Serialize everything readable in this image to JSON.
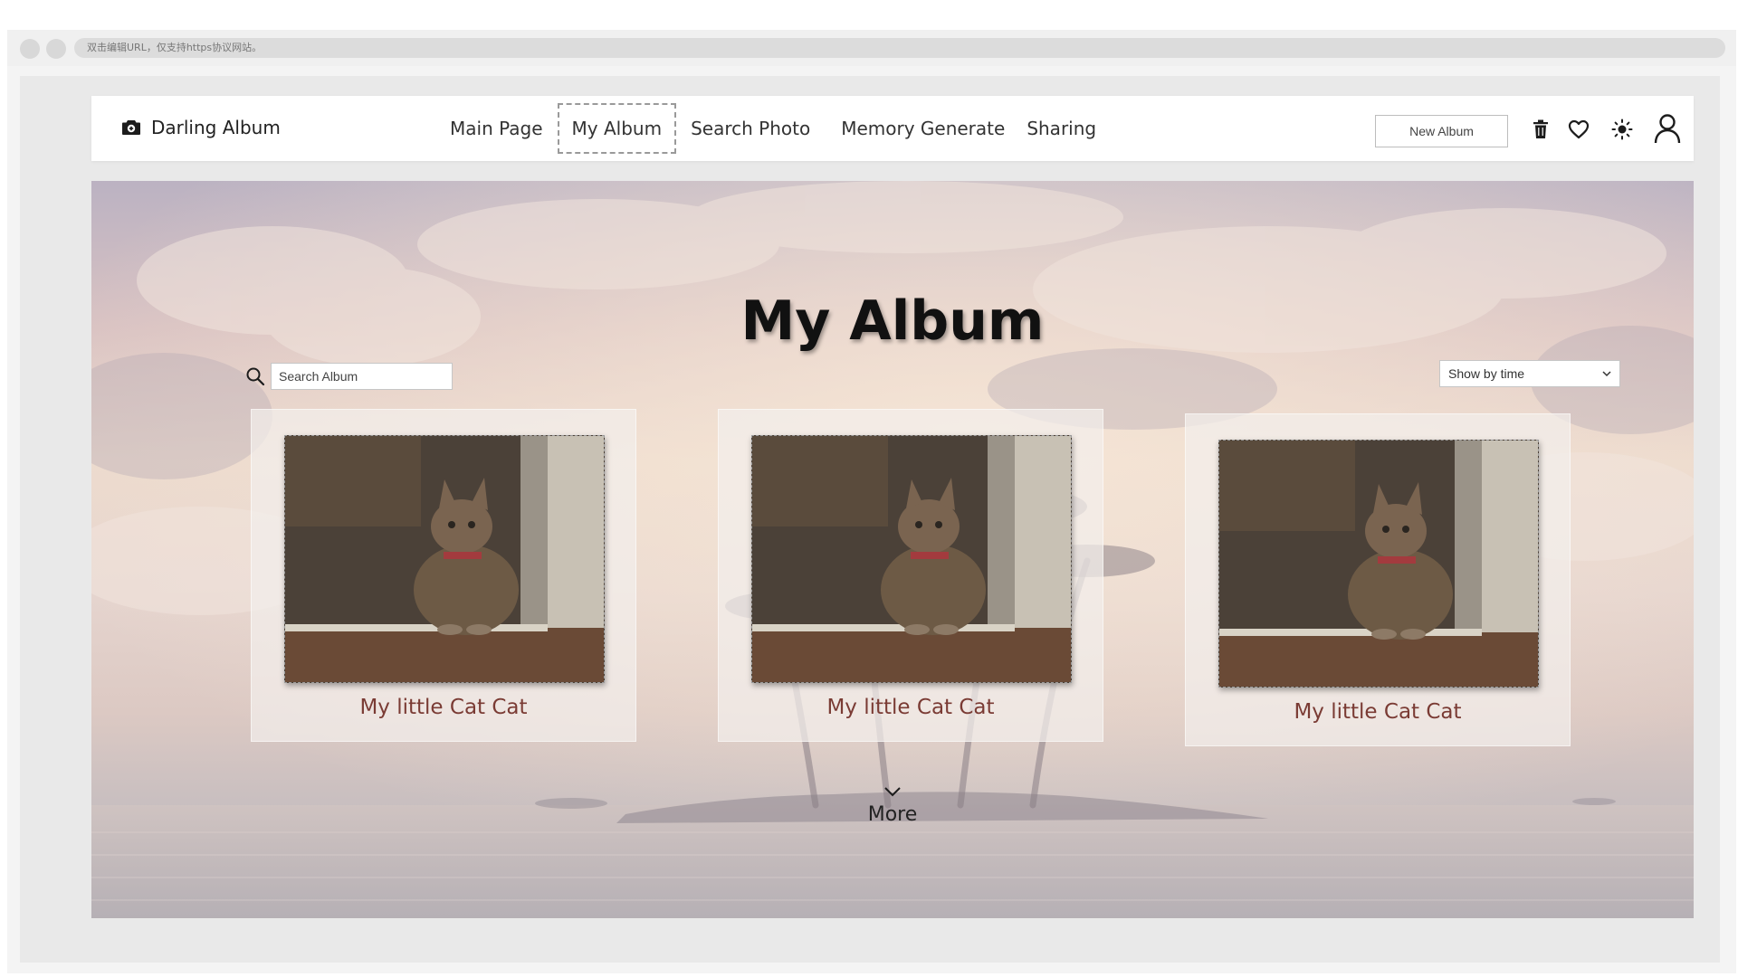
{
  "browser": {
    "url_hint": "双击编辑URL，仅支持https协议网站。"
  },
  "header": {
    "brand_name": "Darling Album",
    "nav": [
      {
        "label": "Main Page",
        "active": false
      },
      {
        "label": "My Album",
        "active": true
      },
      {
        "label": "Search Photo",
        "active": false
      },
      {
        "label": "Memory Generate",
        "active": false
      },
      {
        "label": "Sharing",
        "active": false
      }
    ],
    "new_album_label": "New Album",
    "icons": [
      "trash-icon",
      "heart-icon",
      "sun-icon",
      "user-icon"
    ]
  },
  "main": {
    "title": "My Album",
    "search_placeholder": "Search Album",
    "sort_selected": "Show by time",
    "albums": [
      {
        "label": "My little Cat Cat"
      },
      {
        "label": "My little Cat Cat"
      },
      {
        "label": "My little Cat Cat"
      }
    ],
    "more_label": "More"
  },
  "colors": {
    "album_label": "#7a3b34",
    "active_nav_border": "#9a9a9a"
  }
}
